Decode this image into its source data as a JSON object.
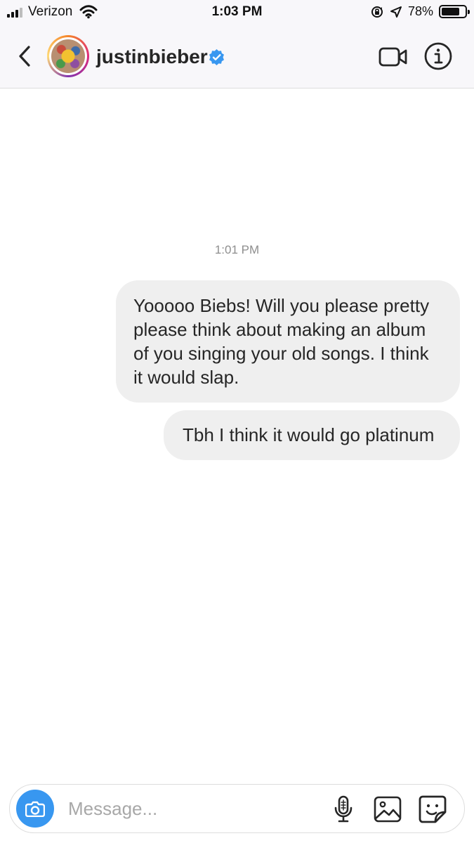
{
  "status_bar": {
    "carrier": "Verizon",
    "time": "1:03 PM",
    "battery_percent": "78%",
    "battery_level": 0.78,
    "icons": [
      "signal-icon",
      "wifi-icon",
      "orientation-lock-icon",
      "location-arrow-icon",
      "battery-icon"
    ]
  },
  "header": {
    "back_icon": "chevron-left-icon",
    "username": "justinbieber",
    "verified": true,
    "verified_color": "#3897f0",
    "video_icon": "video-camera-icon",
    "info_icon": "info-icon"
  },
  "conversation": {
    "timestamp": "1:01 PM",
    "messages": [
      {
        "sender": "me",
        "text": "Yooooo Biebs! Will you please pretty please think about making an album of you singing your old songs. I think it would slap."
      },
      {
        "sender": "me",
        "text": "Tbh I think it would go platinum"
      }
    ]
  },
  "composer": {
    "placeholder": "Message...",
    "camera_icon": "camera-icon",
    "mic_icon": "microphone-icon",
    "gallery_icon": "gallery-icon",
    "sticker_icon": "sticker-icon",
    "camera_button_color": "#3897f0"
  }
}
